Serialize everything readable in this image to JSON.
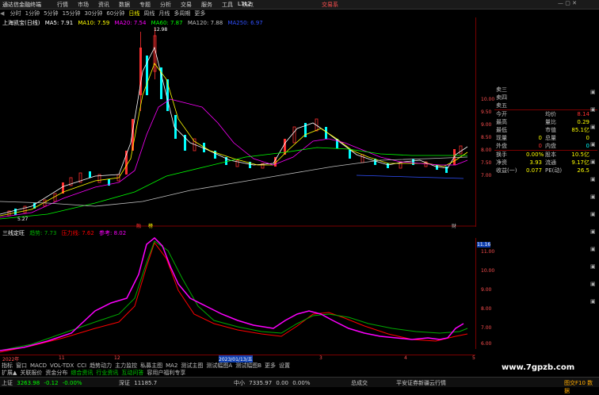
{
  "app": {
    "title": "通达信金融终端",
    "menu": [
      "行情",
      "市场",
      "资讯",
      "数据",
      "专题",
      "分析",
      "交易",
      "服务",
      "工具",
      "热点"
    ],
    "user": "L1L2",
    "trade": "交易系"
  },
  "periods": [
    "分时",
    "1分钟",
    "5分钟",
    "15分钟",
    "30分钟",
    "60分钟",
    "日线",
    "周线",
    "月线",
    "多周期",
    "更多"
  ],
  "active_period": "日线",
  "legend": {
    "name": "上海凯宝(日线)",
    "ma5": "MA5: 7.91",
    "ma10": "MA10: 7.59",
    "ma20": "MA20: 7.54",
    "ma60": "MA60: 7.87",
    "ma120": "MA120: 7.88",
    "ma250": "MA250: 6.97"
  },
  "annotations": {
    "high": "12.98",
    "low": "5.27",
    "tag1": "融",
    "tag2": "榜",
    "tag3": "财"
  },
  "price_axis": [
    "10.00",
    "9.50",
    "9.00",
    "8.50",
    "8.00",
    "7.50",
    "7.00"
  ],
  "indicator": {
    "name": "三线定旺",
    "a": "趋势: 7.73",
    "b": "压力线: 7.62",
    "c": "参考: 8.02"
  },
  "indicator_axis": [
    "11.16",
    "11.00",
    "10.00",
    "9.00",
    "8.00",
    "7.00",
    "6.00"
  ],
  "time_axis": [
    "2022年",
    "11",
    "12",
    "2023/01/13/五",
    "3",
    "4",
    "5"
  ],
  "tabs": [
    "指标",
    "窗口",
    "MACD",
    "VOL-TDX",
    "CCI",
    "趋势动力",
    "主力监控",
    "私募主图",
    "MA2",
    "测试主图",
    "测试幅图A",
    "测试幅图B",
    "更多",
    "设置"
  ],
  "active_tab": "2023/01/13/五",
  "tabs2": [
    "扩展▲",
    "关联报价",
    "资金分布",
    "综合资讯",
    "行业资讯",
    "互动问答",
    "容用户福利专享"
  ],
  "quote": {
    "sell": [
      "卖三",
      "卖四",
      "卖五"
    ],
    "rows": [
      {
        "l1": "今开",
        "v1": "",
        "l2": "均价",
        "v2": "8.14"
      },
      {
        "l1": "最高",
        "v1": "",
        "l2": "量比",
        "v2": "0.29"
      },
      {
        "l1": "最低",
        "v1": "",
        "l2": "市值",
        "v2": "85.1亿"
      },
      {
        "l1": "现量",
        "v1": "0",
        "l2": "总量",
        "v2": "0"
      },
      {
        "l1": "外盘",
        "v1": "0",
        "l2": "内盘",
        "v2": "0"
      },
      {
        "l1": "换手",
        "v1": "0.00%",
        "l2": "股本",
        "v2": "10.5亿"
      },
      {
        "l1": "净资",
        "v1": "3.93",
        "l2": "流通",
        "v2": "9.17亿"
      },
      {
        "l1": "收益(一)",
        "v1": "0.077",
        "l2": "PE(动)",
        "v2": "26.5"
      }
    ]
  },
  "status": {
    "sh_name": "上证",
    "sh_val": "3263.98",
    "sh_chg": "-0.12",
    "sh_pct": "-0.00%",
    "sz_name": "深证",
    "sz_val": "11185.7",
    "zx_name": "中小",
    "zx_val": "7335.97",
    "zx_chg": "0.00",
    "zx_pct": "0.00%",
    "cy_name": "总成交",
    "notice": "平安证券新疆云行情",
    "watermark": "www.7gpzb.com",
    "right": "图交F10 数据"
  },
  "colors": {
    "up": "#ff3030",
    "down": "#00ffff",
    "ma5": "#ffffff",
    "ma10": "#ffff00",
    "ma20": "#ff00ff",
    "ma60": "#00ff00",
    "ma120": "#c0c0c0",
    "ind_a": "#ff00ff",
    "ind_b": "#ff0000",
    "ind_c": "#00aa00"
  }
}
